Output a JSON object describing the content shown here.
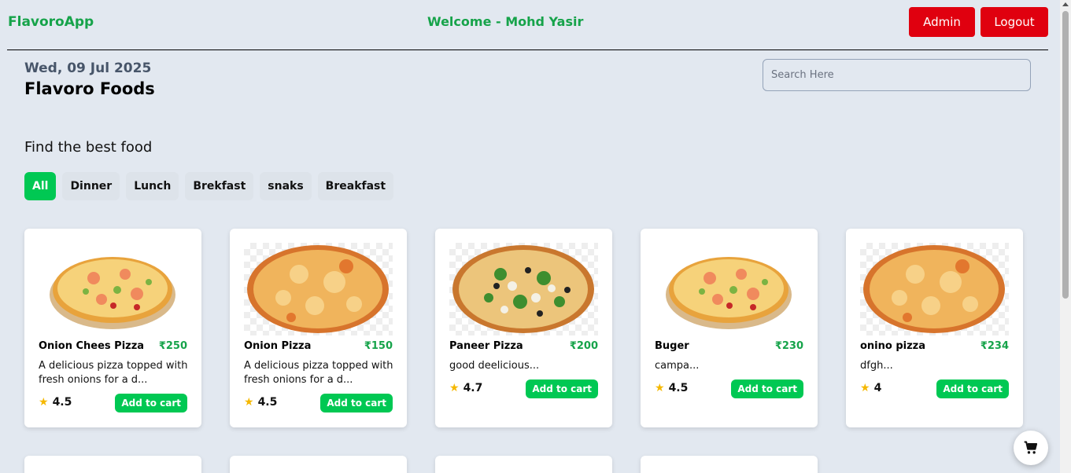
{
  "header": {
    "brand": "FlavoroApp",
    "welcome": "Welcome - Mohd Yasir",
    "admin_label": "Admin",
    "logout_label": "Logout"
  },
  "info": {
    "date": "Wed, 09 Jul 2025",
    "store_name": "Flavoro Foods"
  },
  "search": {
    "placeholder": "Search Here",
    "value": ""
  },
  "section_title": "Find the best food",
  "categories": [
    "All",
    "Dinner",
    "Lunch",
    "Brekfast",
    "snaks",
    "Breakfast"
  ],
  "active_category": "All",
  "cart_button_label": "Add to cart",
  "foods": [
    {
      "name": "Onion Chees Pizza",
      "price": "₹250",
      "desc_line1": "A delicious pizza topped with",
      "desc_line2": "fresh onions for a d...",
      "rating": "4.5",
      "image": "seafood-pizza"
    },
    {
      "name": "Onion Pizza",
      "price": "₹150",
      "desc_line1": "A delicious pizza topped with",
      "desc_line2": "fresh onions for a d...",
      "rating": "4.5",
      "image": "cheese-pizza"
    },
    {
      "name": "Paneer Pizza",
      "price": "₹200",
      "desc_line1": "good deelicious...",
      "desc_line2": "",
      "rating": "4.7",
      "image": "veggie-pizza"
    },
    {
      "name": "Buger",
      "price": "₹230",
      "desc_line1": "campa...",
      "desc_line2": "",
      "rating": "4.5",
      "image": "seafood-pizza"
    },
    {
      "name": "onino pizza",
      "price": "₹234",
      "desc_line1": "dfgh...",
      "desc_line2": "",
      "rating": "4",
      "image": "cheese-pizza"
    }
  ],
  "colors": {
    "accent_green": "#00c853",
    "brand_green": "#16a34a",
    "danger_red": "#e0000f",
    "page_bg": "#e2e8f0",
    "star": "#f5b800"
  },
  "icons": {
    "cart": "cart-icon",
    "star": "star-icon"
  }
}
